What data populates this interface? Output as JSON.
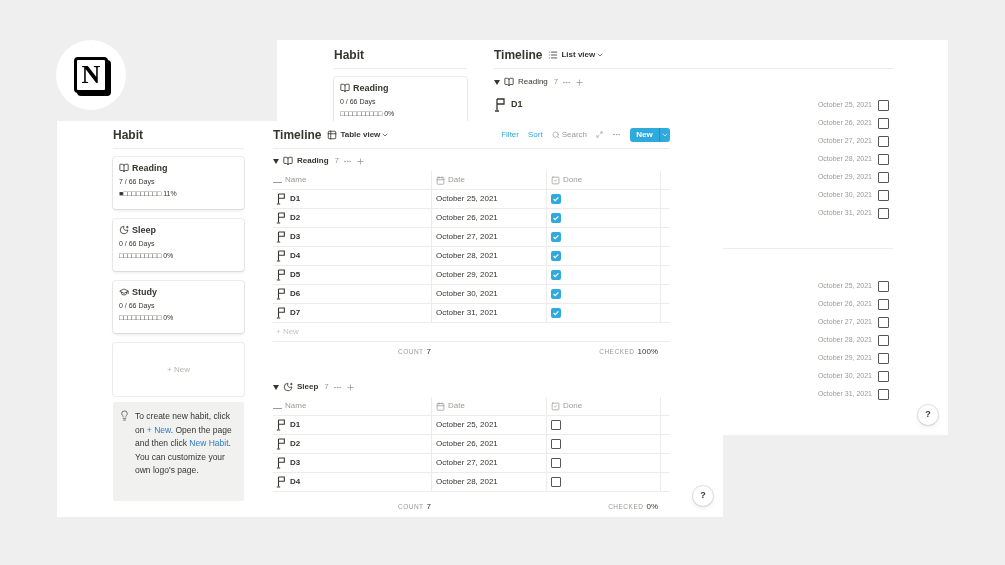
{
  "logo": {
    "letter": "N"
  },
  "back_window": {
    "sidebar": {
      "title": "Habit",
      "cards": [
        {
          "name": "Reading",
          "days": "0 / 66 Days",
          "progress": "□□□□□□□□□□ 0%"
        }
      ]
    },
    "timeline": {
      "title": "Timeline",
      "view": "List view",
      "groups": [
        {
          "name": "Reading",
          "count": "7",
          "rows": [
            {
              "name": "D1",
              "date": "October 25, 2021",
              "done": false
            },
            {
              "date": "October 26, 2021",
              "done": false
            },
            {
              "date": "October 27, 2021",
              "done": false
            },
            {
              "date": "October 28, 2021",
              "done": false
            },
            {
              "date": "October 29, 2021",
              "done": false
            },
            {
              "date": "October 30, 2021",
              "done": false
            },
            {
              "date": "October 31, 2021",
              "done": false
            }
          ]
        },
        {
          "rows": [
            {
              "date": "October 25, 2021",
              "done": false
            },
            {
              "date": "October 26, 2021",
              "done": false
            },
            {
              "date": "October 27, 2021",
              "done": false
            },
            {
              "date": "October 28, 2021",
              "done": false
            },
            {
              "date": "October 29, 2021",
              "done": false
            },
            {
              "date": "October 30, 2021",
              "done": false
            },
            {
              "date": "October 31, 2021",
              "done": false
            }
          ]
        }
      ]
    },
    "help": "?"
  },
  "front_window": {
    "sidebar": {
      "title": "Habit",
      "cards": [
        {
          "name": "Reading",
          "days": "7 / 66 Days",
          "progress": "■□□□□□□□□□ 11%"
        },
        {
          "name": "Sleep",
          "days": "0 / 66 Days",
          "progress": "□□□□□□□□□□ 0%"
        },
        {
          "name": "Study",
          "days": "0 / 66 Days",
          "progress": "□□□□□□□□□□ 0%"
        }
      ],
      "new_card": "+ New",
      "tip": {
        "before": "To create new habit, click on ",
        "link_1": "+ New",
        "middle": ". Open the page and then click ",
        "link_2": "New Habit",
        "after": ". You can customize your own logo's page."
      }
    },
    "timeline": {
      "title": "Timeline",
      "view": "Table view",
      "toolbar": {
        "filter": "Filter",
        "sort": "Sort",
        "search": "Search",
        "new": "New"
      },
      "groups": [
        {
          "name": "Reading",
          "count": "7",
          "columns": [
            "Name",
            "Date",
            "Done"
          ],
          "rows": [
            {
              "name": "D1",
              "date": "October 25, 2021",
              "done": true
            },
            {
              "name": "D2",
              "date": "October 26, 2021",
              "done": true
            },
            {
              "name": "D3",
              "date": "October 27, 2021",
              "done": true
            },
            {
              "name": "D4",
              "date": "October 28, 2021",
              "done": true
            },
            {
              "name": "D5",
              "date": "October 29, 2021",
              "done": true
            },
            {
              "name": "D6",
              "date": "October 30, 2021",
              "done": true
            },
            {
              "name": "D7",
              "date": "October 31, 2021",
              "done": true
            }
          ],
          "new_row": "+ New",
          "footer": {
            "count_label": "COUNT",
            "count": "7",
            "checked_label": "CHECKED",
            "checked": "100%"
          }
        },
        {
          "name": "Sleep",
          "count": "7",
          "columns": [
            "Name",
            "Date",
            "Done"
          ],
          "rows": [
            {
              "name": "D1",
              "date": "October 25, 2021",
              "done": false
            },
            {
              "name": "D2",
              "date": "October 26, 2021",
              "done": false
            },
            {
              "name": "D3",
              "date": "October 27, 2021",
              "done": false
            },
            {
              "name": "D4",
              "date": "October 28, 2021",
              "done": false
            }
          ],
          "footer": {
            "count_label": "COUNT",
            "count": "7",
            "checked_label": "CHECKED",
            "checked": "0%"
          }
        }
      ]
    },
    "help": "?"
  }
}
